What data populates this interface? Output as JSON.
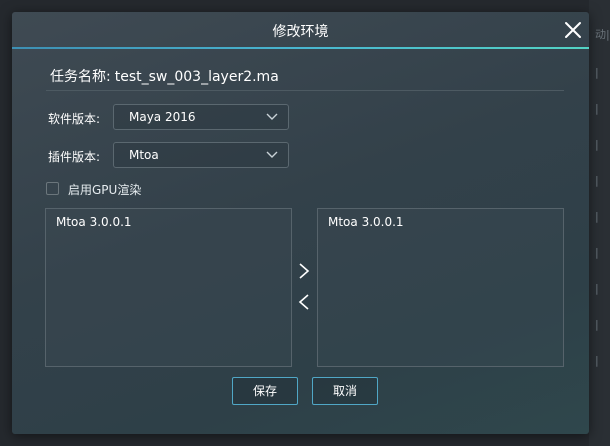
{
  "background": {
    "side_rows": [
      "动|",
      "|",
      "|",
      "|",
      "|",
      "|",
      "|",
      "|",
      "|",
      "|"
    ]
  },
  "dialog": {
    "title": "修改环境",
    "close_icon": "close-icon",
    "task_label": "任务名称:",
    "task_name": "test_sw_003_layer2.ma",
    "software_label": "软件版本:",
    "software_value": "Maya 2016",
    "plugin_label": "插件版本:",
    "plugin_value": "Mtoa",
    "gpu_label": "启用GPU渲染",
    "gpu_checked": false,
    "left_list": {
      "items": [
        "Mtoa 3.0.0.1"
      ]
    },
    "right_list": {
      "items": [
        "Mtoa 3.0.0.1"
      ]
    },
    "move_right_icon": "chevron-right-icon",
    "move_left_icon": "chevron-left-icon",
    "save_label": "保存",
    "cancel_label": "取消"
  },
  "colors": {
    "accent": "#4fb3cf",
    "header_line_end": "#53d3c4",
    "button_border": "#50a7c6",
    "dialog_bg": "#35434b"
  }
}
